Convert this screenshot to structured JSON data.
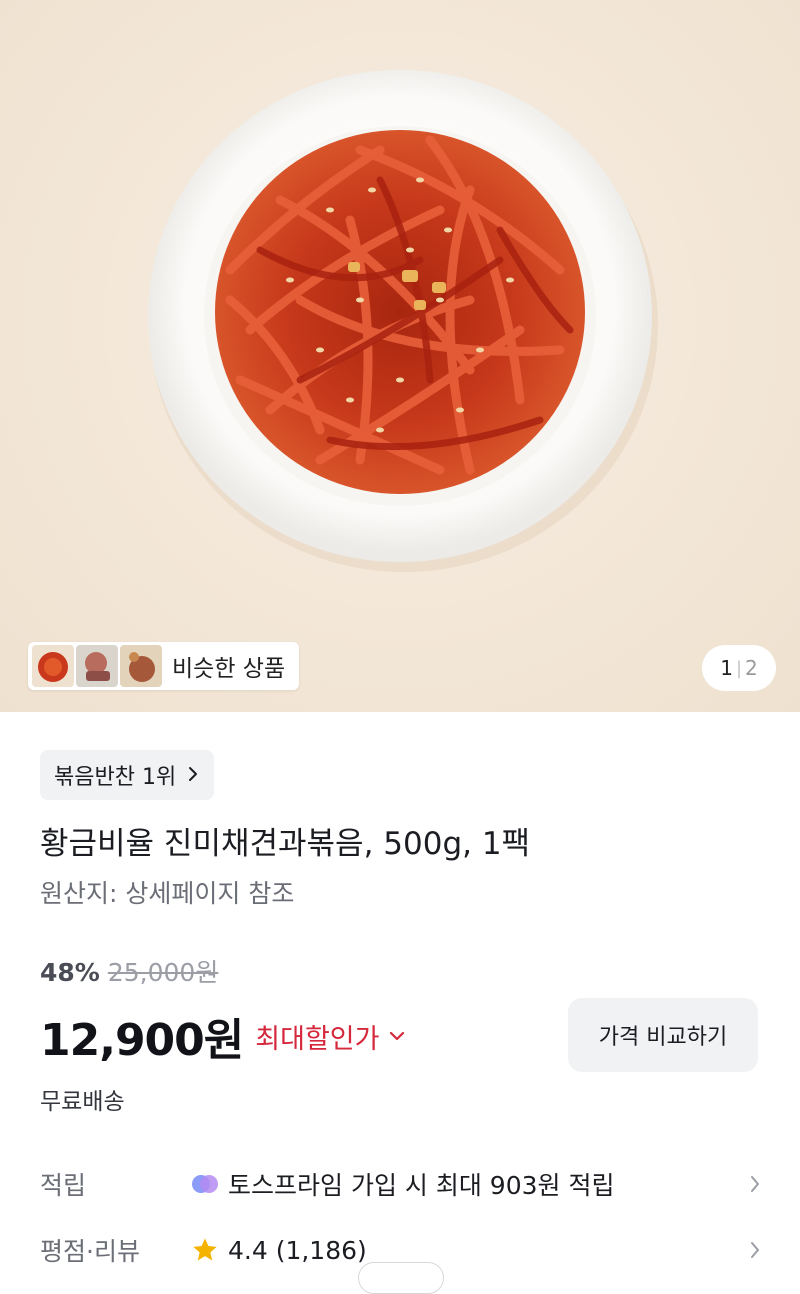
{
  "gallery": {
    "similar_label": "비슷한 상품",
    "page_current": "1",
    "page_separator": "|",
    "page_total": "2"
  },
  "product": {
    "rank_badge": "볶음반찬 1위",
    "title": "황금비율 진미채견과볶음, 500g, 1팩",
    "origin": "원산지: 상세페이지 참조",
    "discount_rate": "48%",
    "original_price": "25,000원",
    "sale_price": "12,900원",
    "max_discount_label": "최대할인가",
    "compare_button": "가격 비교하기",
    "shipping": "무료배송"
  },
  "info_rows": {
    "reward": {
      "label": "적립",
      "value": "토스프라임 가입 시 최대 903원 적립",
      "icon": "toss-prime-icon"
    },
    "review": {
      "label": "평점·리뷰",
      "value": "4.4 (1,186)",
      "icon": "star-icon"
    }
  },
  "colors": {
    "accent_red": "#d6283d",
    "star": "#f5b301",
    "chip_bg": "#f1f2f4"
  }
}
